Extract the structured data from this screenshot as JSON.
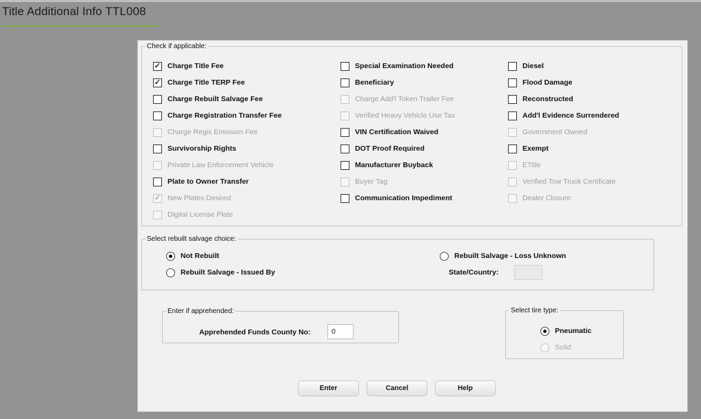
{
  "page": {
    "title": "Title Additional Info TTL008"
  },
  "applicable": {
    "legend": "Check if applicable:",
    "col1": [
      {
        "label": "Charge Title Fee",
        "checked": true,
        "disabled": false
      },
      {
        "label": "Charge Title TERP Fee",
        "checked": true,
        "disabled": false
      },
      {
        "label": "Charge Rebuilt Salvage Fee",
        "checked": false,
        "disabled": false
      },
      {
        "label": "Charge Registration Transfer Fee",
        "checked": false,
        "disabled": false
      },
      {
        "label": "Charge Regis Emission Fee",
        "checked": false,
        "disabled": true
      },
      {
        "label": "Survivorship Rights",
        "checked": false,
        "disabled": false
      },
      {
        "label": "Private Law Enforcement Vehicle",
        "checked": false,
        "disabled": true
      },
      {
        "label": "Plate to Owner Transfer",
        "checked": false,
        "disabled": false
      },
      {
        "label": "New Plates Desired",
        "checked": true,
        "disabled": true
      },
      {
        "label": "Digital License Plate",
        "checked": false,
        "disabled": true
      }
    ],
    "col2": [
      {
        "label": "Special Examination Needed",
        "checked": false,
        "disabled": false
      },
      {
        "label": "Beneficiary",
        "checked": false,
        "disabled": false
      },
      {
        "label": "Charge Add'l Token Trailer Fee",
        "checked": false,
        "disabled": true
      },
      {
        "label": "Verified Heavy Vehicle Use Tax",
        "checked": false,
        "disabled": true
      },
      {
        "label": "VIN Certification Waived",
        "checked": false,
        "disabled": false
      },
      {
        "label": "DOT Proof Required",
        "checked": false,
        "disabled": false
      },
      {
        "label": "Manufacturer Buyback",
        "checked": false,
        "disabled": false
      },
      {
        "label": "Buyer Tag",
        "checked": false,
        "disabled": true
      },
      {
        "label": "Communication Impediment",
        "checked": false,
        "disabled": false
      }
    ],
    "col3": [
      {
        "label": "Diesel",
        "checked": false,
        "disabled": false
      },
      {
        "label": "Flood Damage",
        "checked": false,
        "disabled": false
      },
      {
        "label": "Reconstructed",
        "checked": false,
        "disabled": false
      },
      {
        "label": "Add'l Evidence Surrendered",
        "checked": false,
        "disabled": false
      },
      {
        "label": "Government Owned",
        "checked": false,
        "disabled": true
      },
      {
        "label": "Exempt",
        "checked": false,
        "disabled": false
      },
      {
        "label": "ETitle",
        "checked": false,
        "disabled": true
      },
      {
        "label": "Verified Tow Truck Certificate",
        "checked": false,
        "disabled": true
      },
      {
        "label": "Dealer Closure",
        "checked": false,
        "disabled": true
      }
    ]
  },
  "salvage": {
    "legend": "Select rebuilt salvage choice:",
    "options": [
      {
        "label": "Not Rebuilt",
        "selected": true
      },
      {
        "label": "Rebuilt Salvage - Issued By",
        "selected": false
      },
      {
        "label": "Rebuilt Salvage - Loss Unknown",
        "selected": false
      }
    ],
    "state_label": "State/Country:",
    "state_value": ""
  },
  "apprehended": {
    "legend": "Enter if apprehended:",
    "county_label": "Apprehended Funds County No:",
    "county_value": "0"
  },
  "tire": {
    "legend": "Select tire type:",
    "options": [
      {
        "label": "Pneumatic",
        "selected": true,
        "disabled": false
      },
      {
        "label": "Solid",
        "selected": false,
        "disabled": true
      }
    ]
  },
  "buttons": {
    "enter": "Enter",
    "cancel": "Cancel",
    "help": "Help"
  }
}
